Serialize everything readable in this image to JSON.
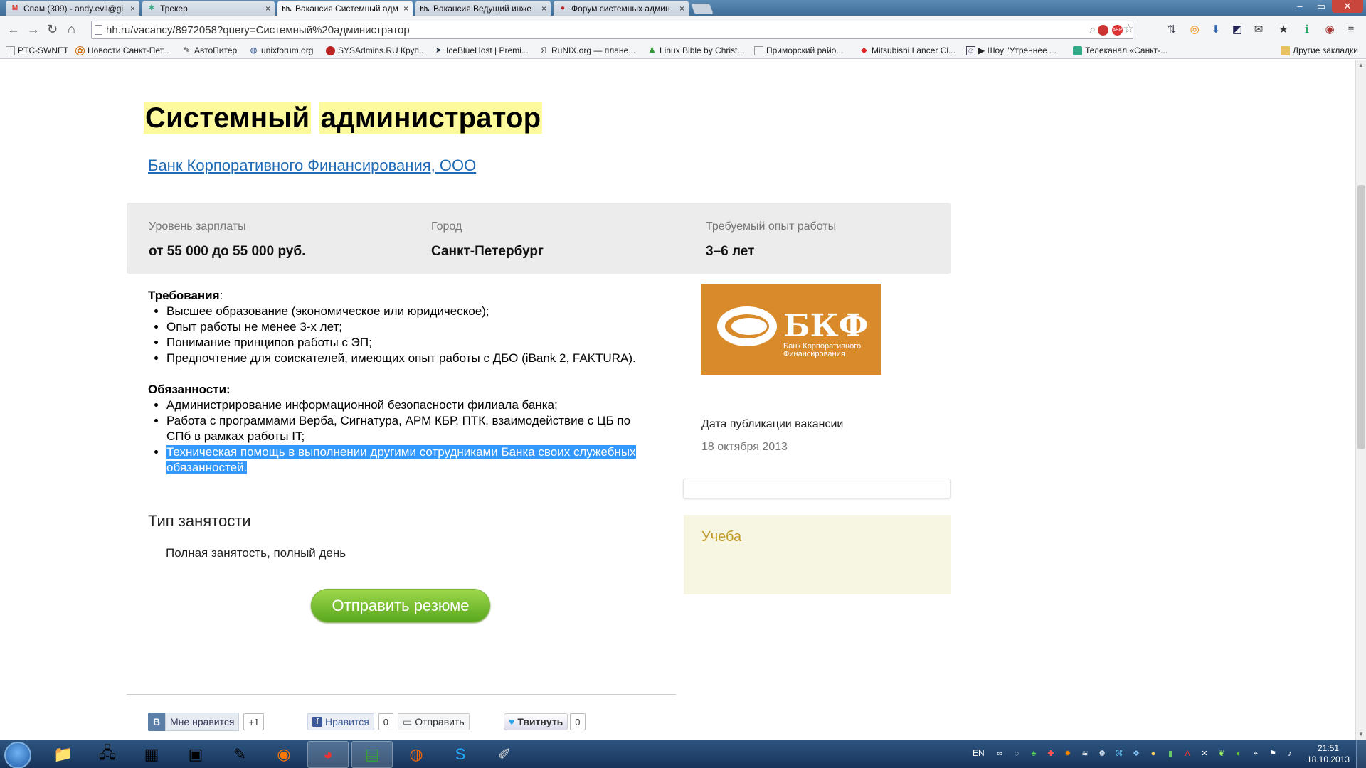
{
  "browser": {
    "tabs": [
      {
        "label": "Спам (309) - andy.evil@gi",
        "favicon": "gmail-icon",
        "color": "#d93025",
        "glyph": "M"
      },
      {
        "label": "Трекер",
        "favicon": "tracker-icon",
        "color": "#4a8",
        "glyph": "✱"
      },
      {
        "label": "Вакансия Системный адм",
        "favicon": "hh-icon",
        "color": "#222",
        "glyph": "hh."
      },
      {
        "label": "Вакансия Ведущий инже",
        "favicon": "hh-icon",
        "color": "#222",
        "glyph": "hh."
      },
      {
        "label": "Форум системных админ",
        "favicon": "forum-icon",
        "color": "#b22",
        "glyph": "●"
      }
    ],
    "tab_close": "×",
    "url": "hh.ru/vacancy/8972058?query=Системный%20администратор",
    "bookmarks": [
      {
        "label": "PTC-SWNET",
        "icon": "page-icon"
      },
      {
        "label": "Новости Санкт-Пет...",
        "icon": "news-icon"
      },
      {
        "label": "АвтоПитер",
        "icon": "wrench-icon"
      },
      {
        "label": "unixforum.org",
        "icon": "globe-icon"
      },
      {
        "label": "SYSAdmins.RU Круп...",
        "icon": "sysadmins-icon"
      },
      {
        "label": "IceBlueHost | Premi...",
        "icon": "iceblue-icon"
      },
      {
        "label": "RuNIX.org — плане...",
        "icon": "runix-icon"
      },
      {
        "label": "Linux Bible by Christ...",
        "icon": "linux-icon"
      },
      {
        "label": "Приморский райо...",
        "icon": "page-icon"
      },
      {
        "label": "Mitsubishi Lancer Cl...",
        "icon": "mitsubishi-icon"
      },
      {
        "label": "▶ Шоу \"Утреннее ...",
        "icon": "video-icon"
      },
      {
        "label": "Телеканал «Санкт-...",
        "icon": "tv-icon"
      }
    ],
    "other_bookmarks": "Другие закладки"
  },
  "vacancy": {
    "title_word1": "Системный",
    "title_word2": "администратор",
    "company": "Банк Корпоративного Финансирования, ООО",
    "salary_label": "Уровень зарплаты",
    "salary_value": "от 55 000 до 55 000 руб.",
    "city_label": "Город",
    "city_value": "Санкт-Петербург",
    "exp_label": "Требуемый опыт работы",
    "exp_value": "3–6 лет",
    "requirements_heading": "Требования",
    "requirements_colon": ":",
    "requirements": [
      "Высшее образование (экономическое или юридическое);",
      "Опыт работы не менее 3-х лет;",
      "Понимание принципов работы с ЭП;",
      "Предпочтение для соискателей, имеющих опыт работы с ДБО (iBank 2, FAKTURA)."
    ],
    "duties_heading": "Обязанности:",
    "duties": [
      "Администрирование информационной безопасности филиала банка;",
      "Работа с программами Верба, Сигнатура, АРМ КБР, ПТК, взаимодействие с ЦБ по СПб в рамках работы IT;",
      "Техническая помощь в выполнении другими сотрудниками Банка своих служебных обязанностей."
    ],
    "employment_heading": "Тип занятости",
    "employment_value": "Полная занятость, полный день",
    "apply_button": "Отправить резюме",
    "logo_text": "БКФ",
    "logo_subtext": "Банк Корпоративного Финансирования",
    "pub_label": "Дата публикации вакансии",
    "pub_date": "18 октября 2013",
    "study_label": "Учеба"
  },
  "social": {
    "vk_letter": "В",
    "vk_like": "Мне нравится",
    "plus_one": "+1",
    "fb_like": "Нравится",
    "fb_count": "0",
    "fb_send": "Отправить",
    "tweet": "Твитнуть",
    "tweet_count": "0"
  },
  "taskbar": {
    "lang": "EN",
    "time": "21:51",
    "date": "18.10.2013"
  },
  "colors": {
    "highlight": "#fdfa9e",
    "link": "#1f6bb5",
    "selection": "#3399ff",
    "apply_green": "#6ab82a",
    "logo_orange": "#d98a2a"
  }
}
